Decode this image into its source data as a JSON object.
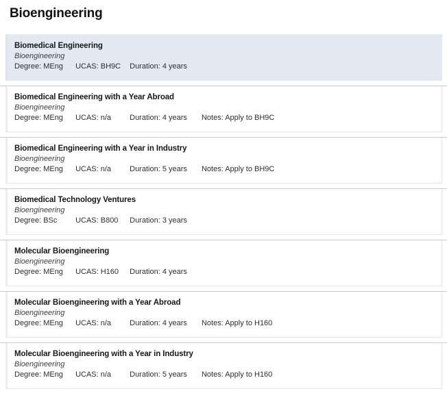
{
  "page": {
    "title": "Bioengineering"
  },
  "labels": {
    "degree_prefix": "Degree: ",
    "ucas_prefix": "UCAS: ",
    "duration_prefix": "Duration: ",
    "notes_prefix": "Notes: "
  },
  "colors": {
    "selected_background": "#e4e8f0",
    "card_background": "#ffffff",
    "card_border": "#e2e4ee",
    "separator": "#c9c9c9",
    "title_text": "#111111",
    "body_text": "#2d2d33",
    "department_text": "#3e3e46"
  },
  "courses": [
    {
      "name": "Biomedical Engineering",
      "department": "Bioengineering",
      "degree": "Degree: MEng",
      "ucas": "UCAS: BH9C",
      "duration": "Duration: 4 years",
      "notes": "",
      "selected": true
    },
    {
      "name": "Biomedical Engineering with a Year Abroad",
      "department": "Bioengineering",
      "degree": "Degree: MEng",
      "ucas": "UCAS: n/a",
      "duration": "Duration: 4 years",
      "notes": "Notes: Apply to BH9C",
      "selected": false
    },
    {
      "name": "Biomedical Engineering with a Year in Industry",
      "department": "Bioengineering",
      "degree": "Degree: MEng",
      "ucas": "UCAS: n/a",
      "duration": "Duration: 5 years",
      "notes": "Notes: Apply to BH9C",
      "selected": false
    },
    {
      "name": "Biomedical Technology Ventures",
      "department": "Bioengineering",
      "degree": "Degree: BSc",
      "ucas": "UCAS: B800",
      "duration": "Duration: 3 years",
      "notes": "",
      "selected": false
    },
    {
      "name": "Molecular Bioengineering",
      "department": "Bioengineering",
      "degree": "Degree: MEng",
      "ucas": "UCAS: H160",
      "duration": "Duration: 4 years",
      "notes": "",
      "selected": false
    },
    {
      "name": "Molecular Bioengineering with a Year Abroad",
      "department": "Bioengineering",
      "degree": "Degree: MEng",
      "ucas": "UCAS: n/a",
      "duration": "Duration: 4 years",
      "notes": "Notes: Apply to H160",
      "selected": false
    },
    {
      "name": "Molecular Bioengineering with a Year in Industry",
      "department": "Bioengineering",
      "degree": "Degree: MEng",
      "ucas": "UCAS: n/a",
      "duration": "Duration: 5 years",
      "notes": "Notes: Apply to H160",
      "selected": false
    }
  ]
}
